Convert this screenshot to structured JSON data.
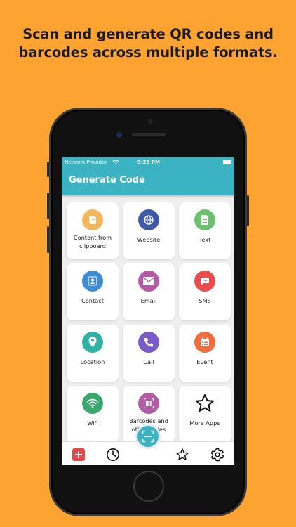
{
  "promo": {
    "line1": "Scan and generate QR codes and",
    "line2": "barcodes across multiple formats."
  },
  "status_bar": {
    "carrier": "Network Provider",
    "time": "9:20 PM"
  },
  "appbar": {
    "title": "Generate Code"
  },
  "colors": {
    "background": "#FDA331",
    "accent": "#3BB3C2"
  },
  "tiles": [
    {
      "label": "Content from clipboard",
      "icon": "clipboard-icon",
      "color": "#F3B65A"
    },
    {
      "label": "Website",
      "icon": "globe-icon",
      "color": "#3F5AA8"
    },
    {
      "label": "Text",
      "icon": "document-icon",
      "color": "#6CC16C"
    },
    {
      "label": "Contact",
      "icon": "person-icon",
      "color": "#3E8BD6"
    },
    {
      "label": "Email",
      "icon": "envelope-icon",
      "color": "#B758A8"
    },
    {
      "label": "SMS",
      "icon": "chat-icon",
      "color": "#EA4C4C"
    },
    {
      "label": "Location",
      "icon": "location-pin-icon",
      "color": "#2FB1A5"
    },
    {
      "label": "Call",
      "icon": "phone-icon",
      "color": "#7B5BC9"
    },
    {
      "label": "Event",
      "icon": "calendar-icon",
      "color": "#F26C3C"
    },
    {
      "label": "Wifi",
      "icon": "wifi-icon",
      "color": "#38A86C"
    },
    {
      "label": "Barcodes and other codes",
      "icon": "barcode-icon",
      "color": "#B45BA6"
    },
    {
      "label": "More Apps",
      "icon": "star-outline-icon",
      "color": "#ffffff"
    }
  ],
  "bottom_nav": [
    {
      "name": "generate",
      "icon": "plus-icon"
    },
    {
      "name": "history",
      "icon": "clock-icon"
    },
    {
      "name": "scan",
      "icon": "scan-icon"
    },
    {
      "name": "favorites",
      "icon": "star-icon"
    },
    {
      "name": "settings",
      "icon": "gear-icon"
    }
  ]
}
